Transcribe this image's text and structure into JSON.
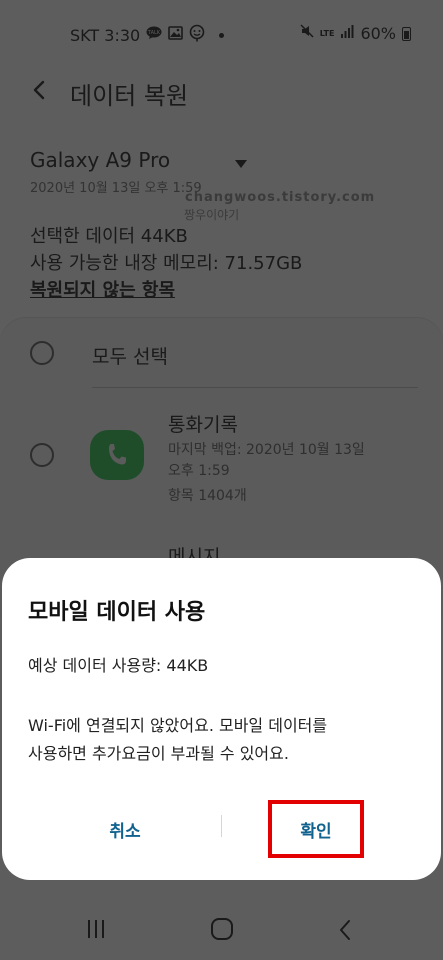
{
  "status_bar": {
    "carrier_time": "SKT 3:30",
    "network": "LTE",
    "battery": "60%",
    "icons": [
      "talk-bubble-icon",
      "image-icon",
      "emoji-icon",
      "mute-icon",
      "signal-icon",
      "battery-icon"
    ]
  },
  "app_bar": {
    "title": "데이터 복원",
    "back_icon": "chevron-left-icon"
  },
  "device": {
    "name": "Galaxy A9 Pro",
    "date": "2020년 10월 13일 오후 1:59",
    "watermark_url": "changwoos.tistory.com",
    "watermark_name": "짱우이야기",
    "selected_data": "선택한 데이터 44KB",
    "available_memory": "사용 가능한 내장 메모리: 71.57GB",
    "not_restored_link": "복원되지 않는 항목"
  },
  "list": {
    "select_all": "모두 선택",
    "items": [
      {
        "title": "통화기록",
        "backup_line1": "마지막 백업: 2020년 10월 13일",
        "backup_line2": "오후 1:59",
        "count": "항목 1404개",
        "icon": "phone-icon",
        "icon_color": "#1f4d2a"
      },
      {
        "title": "메시지"
      }
    ]
  },
  "dialog": {
    "title": "모바일 데이터 사용",
    "usage": "예상 데이터 사용량: 44KB",
    "message_line1": "Wi-Fi에 연결되지 않았어요. 모바일 데이터를",
    "message_line2": "사용하면 추가요금이 부과될 수 있어요.",
    "cancel_label": "취소",
    "ok_label": "확인",
    "button_color": "#11628e",
    "highlight_color": "#e30000"
  },
  "nav_bar": {
    "icons": [
      "recents-icon",
      "home-icon",
      "back-icon"
    ]
  }
}
